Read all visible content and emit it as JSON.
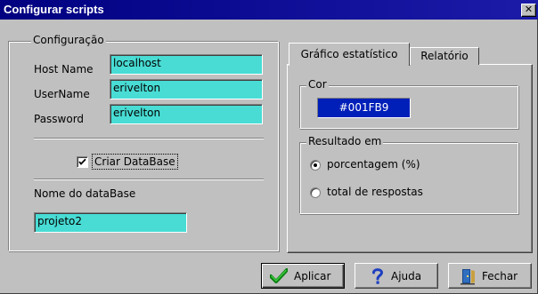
{
  "window": {
    "title": "Configurar scripts",
    "close_glyph": "✕"
  },
  "config": {
    "legend": "Configuração",
    "host": {
      "label": "Host Name",
      "value": "localhost"
    },
    "user": {
      "label": "UserName",
      "value": "erivelton"
    },
    "password": {
      "label": "Password",
      "value": "erivelton"
    },
    "create_db": {
      "label": "Criar DataBase",
      "checked": true
    },
    "db_name": {
      "label": "Nome do dataBase",
      "value": "projeto2"
    }
  },
  "tabs": [
    {
      "label": "Gráfico estatístico",
      "active": true
    },
    {
      "label": "Relatório",
      "active": false
    }
  ],
  "chart_tab": {
    "color_legend": "Cor",
    "color_value": "#001FB9",
    "result_legend": "Resultado em",
    "options": [
      {
        "label": "porcentagem (%)",
        "selected": true
      },
      {
        "label": "total de respostas",
        "selected": false
      }
    ]
  },
  "buttons": {
    "apply": "Aplicar",
    "help": "Ajuda",
    "close": "Fechar"
  },
  "colors": {
    "title_bar": "#000080",
    "field_bg": "#48DCD4",
    "swatch": "#001FB9",
    "window_bg": "#C0C0C0"
  },
  "icons": {
    "apply": "green-checkmark-icon",
    "help": "question-mark-icon",
    "close": "door-exit-icon",
    "checkbox": "checkmark-icon"
  }
}
